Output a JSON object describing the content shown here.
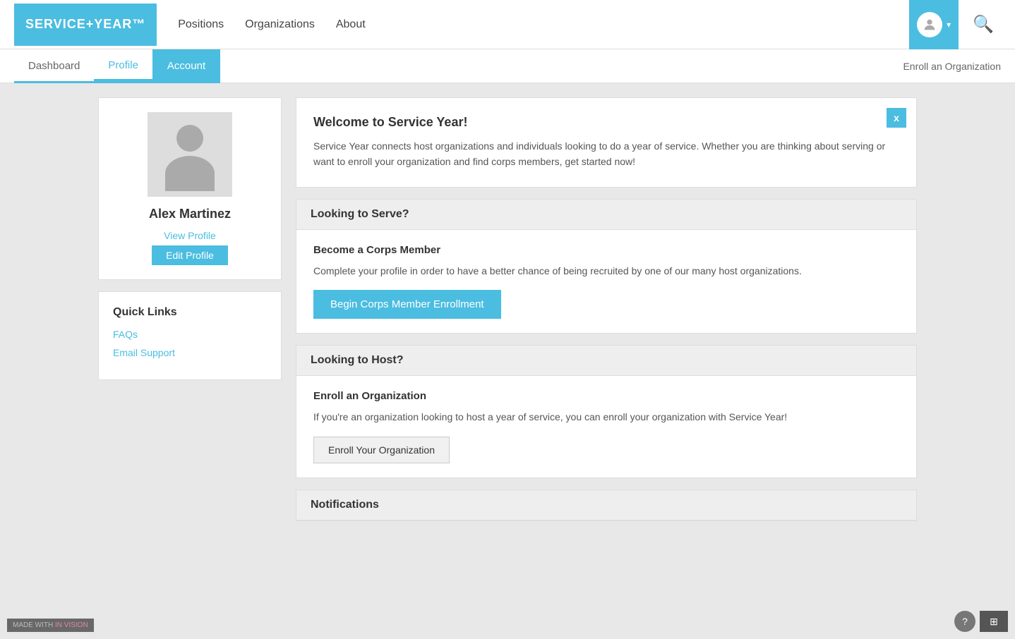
{
  "logo": {
    "text": "SERVICE+YEAR™"
  },
  "nav": {
    "links": [
      {
        "label": "Positions",
        "name": "nav-positions"
      },
      {
        "label": "Organizations",
        "name": "nav-organizations"
      },
      {
        "label": "About",
        "name": "nav-about"
      }
    ]
  },
  "subnav": {
    "links": [
      {
        "label": "Dashboard",
        "name": "tab-dashboard",
        "state": "underline"
      },
      {
        "label": "Profile",
        "name": "tab-profile",
        "state": "active-underline"
      },
      {
        "label": "Account",
        "name": "tab-account",
        "state": "active-bg"
      }
    ],
    "enroll_link": "Enroll an Organization"
  },
  "sidebar": {
    "profile": {
      "name": "Alex Martinez",
      "view_label": "View Profile",
      "edit_label": "Edit Profile"
    },
    "quick_links": {
      "title": "Quick Links",
      "links": [
        {
          "label": "FAQs",
          "name": "link-faqs"
        },
        {
          "label": "Email Support",
          "name": "link-email-support"
        }
      ]
    }
  },
  "welcome": {
    "title": "Welcome to Service Year!",
    "text": "Service Year connects host organizations and individuals looking to do a year of service. Whether you are thinking about serving or want to enroll your organization and find corps members, get started now!",
    "close_label": "x"
  },
  "looking_to_serve": {
    "header": "Looking to Serve?",
    "subtitle": "Become a Corps Member",
    "text": "Complete your profile in order to have a better chance of being recruited by one of our many host organizations.",
    "button_label": "Begin Corps Member Enrollment"
  },
  "looking_to_host": {
    "header": "Looking to Host?",
    "subtitle": "Enroll an Organization",
    "text": "If you're an organization looking to host a year of service, you can enroll your organization with Service Year!",
    "button_label": "Enroll Your Organization"
  },
  "notifications": {
    "header": "Notifications"
  },
  "footer": {
    "made_with": "MADE WITH",
    "invision": "IN VISION",
    "help_label": "?",
    "grid_label": "⊞"
  }
}
